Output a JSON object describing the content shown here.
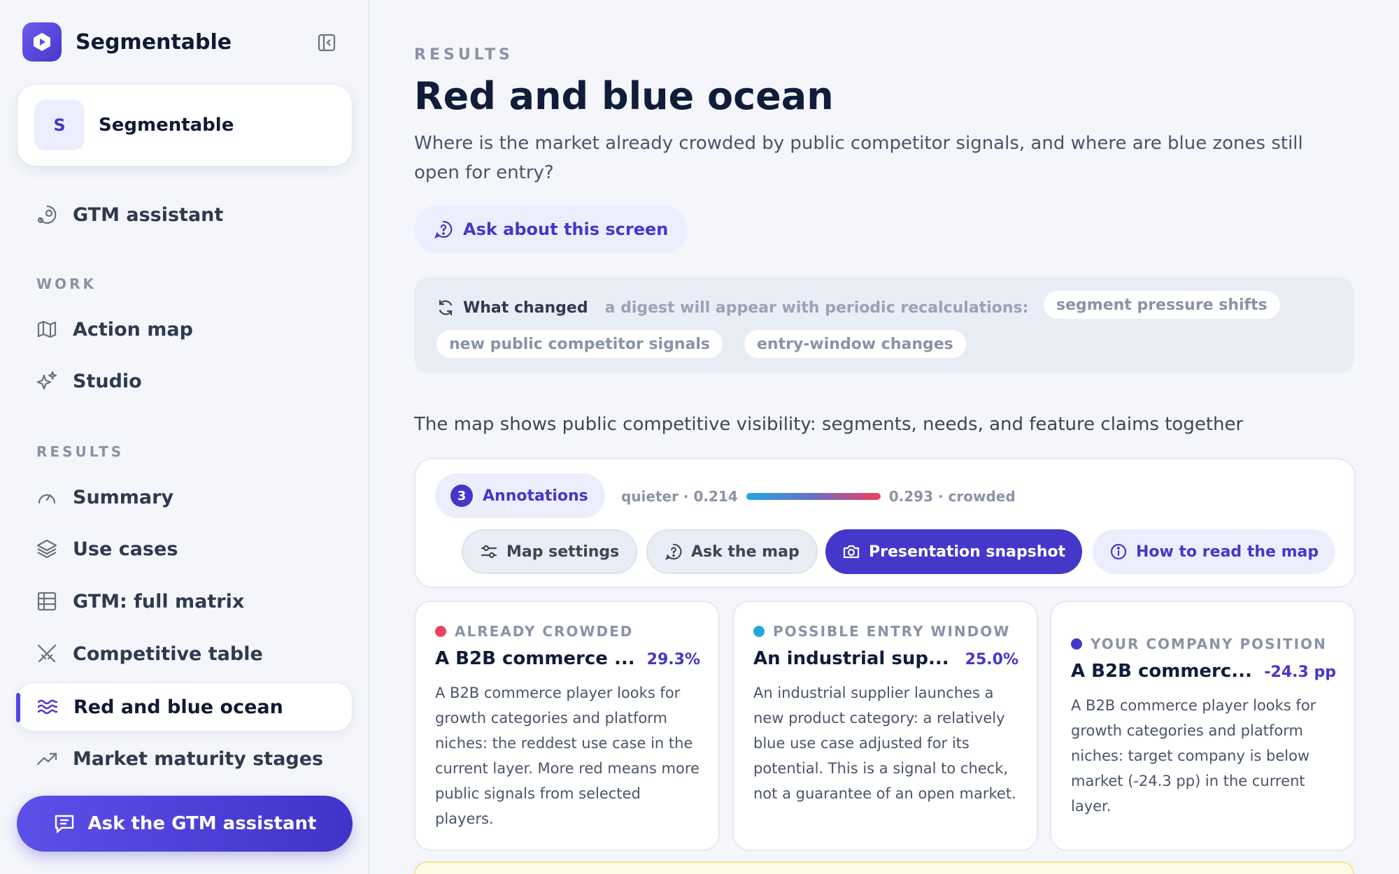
{
  "brand": {
    "name": "Segmentable"
  },
  "workspace": {
    "initial": "S",
    "name": "Segmentable"
  },
  "sidebar": {
    "assistant_item": {
      "label": "GTM assistant",
      "icon": "assistant-icon"
    },
    "work_section": "WORK",
    "work_items": [
      {
        "label": "Action map",
        "icon": "map-icon"
      },
      {
        "label": "Studio",
        "icon": "sparkle-icon"
      }
    ],
    "results_section": "RESULTS",
    "results_items": [
      {
        "label": "Summary",
        "icon": "gauge-icon"
      },
      {
        "label": "Use cases",
        "icon": "layers-icon"
      },
      {
        "label": "GTM: full matrix",
        "icon": "grid-icon"
      },
      {
        "label": "Competitive table",
        "icon": "swords-icon"
      },
      {
        "label": "Red and blue ocean",
        "icon": "waves-icon",
        "active": true
      },
      {
        "label": "Market maturity stages",
        "icon": "trend-icon"
      }
    ],
    "cta": "Ask the GTM assistant"
  },
  "page": {
    "eyebrow": "RESULTS",
    "title": "Red and blue ocean",
    "subtitle": "Where is the market already crowded by public competitor signals, and where are blue zones still open for entry?",
    "ask_button": "Ask about this screen"
  },
  "changes": {
    "title": "What changed",
    "description": "a digest will appear with periodic recalculations:",
    "chips": [
      "segment pressure shifts",
      "new public competitor signals",
      "entry-window changes"
    ]
  },
  "map": {
    "caption": "The map shows public competitive visibility: segments, needs, and feature claims together",
    "annotations_count": "3",
    "annotations_label": "Annotations",
    "legend_min": "quieter · 0.214",
    "legend_max": "0.293 · crowded",
    "buttons": {
      "settings": "Map settings",
      "ask": "Ask the map",
      "snapshot": "Presentation snapshot",
      "howto": "How to read the map"
    }
  },
  "cards": [
    {
      "label": "ALREADY CROWDED",
      "dot_color": "#f0405f",
      "title": "A B2B commerce ...",
      "metric": "29.3%",
      "body": "A B2B commerce player looks for growth categories and platform niches: the reddest use case in the current layer. More red means more public signals from selected players."
    },
    {
      "label": "POSSIBLE ENTRY WINDOW",
      "dot_color": "#22a7e0",
      "title": "An industrial sup...",
      "metric": "25.0%",
      "body": "An industrial supplier launches a new product category: a relatively blue use case adjusted for its potential. This is a signal to check, not a guarantee of an open market."
    },
    {
      "label": "YOUR COMPANY POSITION",
      "dot_color": "#4338ca",
      "title": "A B2B commerc...",
      "metric": "-24.3 pp",
      "body": "A B2B commerce player looks for growth categories and platform niches: target company is below market (-24.3 pp) in the current layer."
    }
  ],
  "colors": {
    "accent": "#4338ca",
    "crowded": "#f0405f",
    "blue_zone": "#22a7e0"
  }
}
